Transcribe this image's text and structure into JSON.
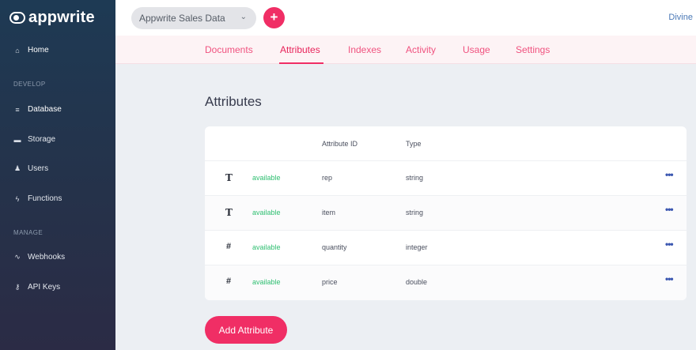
{
  "app": {
    "name": "appwrite"
  },
  "sidebar": {
    "items": [
      {
        "label": "Home",
        "icon": "home-icon",
        "glyph": "🏠"
      },
      {
        "label": "Database",
        "icon": "database-icon",
        "glyph": "≡"
      },
      {
        "label": "Storage",
        "icon": "folder-icon",
        "glyph": "▬"
      },
      {
        "label": "Users",
        "icon": "users-icon",
        "glyph": "👥"
      },
      {
        "label": "Functions",
        "icon": "bolt-icon",
        "glyph": "⚡"
      },
      {
        "label": "Webhooks",
        "icon": "webhooks-icon",
        "glyph": "✎"
      },
      {
        "label": "API Keys",
        "icon": "key-icon",
        "glyph": "🔑"
      }
    ],
    "sections": {
      "develop": "DEVELOP",
      "manage": "MANAGE"
    },
    "active": "Database"
  },
  "topbar": {
    "selector_value": "Appwrite Sales Data",
    "user_name": "Divine",
    "add_symbol": "+"
  },
  "tabs": [
    "Documents",
    "Attributes",
    "Indexes",
    "Activity",
    "Usage",
    "Settings"
  ],
  "active_tab": "Attributes",
  "main": {
    "title": "Attributes",
    "columns": {
      "id": "Attribute ID",
      "type": "Type"
    },
    "rows": [
      {
        "icon": "T",
        "icon_name": "text-type-icon",
        "status": "available",
        "id": "rep",
        "type": "string"
      },
      {
        "icon": "T",
        "icon_name": "text-type-icon",
        "status": "available",
        "id": "item",
        "type": "string"
      },
      {
        "icon": "#",
        "icon_name": "number-type-icon",
        "status": "available",
        "id": "quantity",
        "type": "integer"
      },
      {
        "icon": "#",
        "icon_name": "number-type-icon",
        "status": "available",
        "id": "price",
        "type": "double"
      }
    ],
    "more_symbol": "•••",
    "add_button": "Add Attribute"
  },
  "colors": {
    "accent": "#f02e65",
    "available": "#2fbf71",
    "link": "#4a78b6"
  }
}
